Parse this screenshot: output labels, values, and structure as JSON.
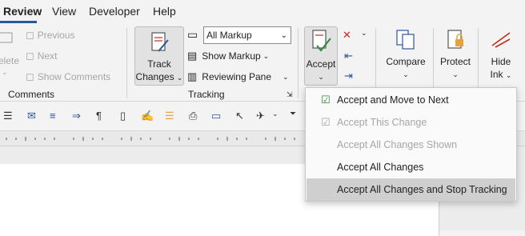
{
  "tabs": [
    {
      "label": "Review",
      "active": true
    },
    {
      "label": "View"
    },
    {
      "label": "Developer"
    },
    {
      "label": "Help"
    }
  ],
  "comments": {
    "partial_left_label": "elete",
    "previous": "Previous",
    "next": "Next",
    "show_comments": "Show Comments",
    "group_label": "Comments"
  },
  "tracking": {
    "track_changes_line1": "Track",
    "track_changes_line2": "Changes",
    "markup_combo": "All Markup",
    "show_markup": "Show Markup",
    "reviewing_pane": "Reviewing Pane",
    "group_label": "Tracking"
  },
  "accept": {
    "label": "Accept"
  },
  "compare": {
    "label": "Compare"
  },
  "protect": {
    "label": "Protect"
  },
  "hide_ink": {
    "line1": "Hide",
    "line2": "Ink"
  },
  "accept_menu": {
    "items": [
      {
        "label": "Accept and Move to Next",
        "enabled": true,
        "highlighted": false,
        "icon": "accept-move-next-icon"
      },
      {
        "label": "Accept This Change",
        "enabled": false,
        "highlighted": false,
        "icon": "accept-this-change-icon"
      },
      {
        "label": "Accept All Changes Shown",
        "enabled": false,
        "highlighted": false
      },
      {
        "label": "Accept All Changes",
        "enabled": true,
        "highlighted": false
      },
      {
        "label": "Accept All Changes and Stop Tracking",
        "enabled": true,
        "highlighted": true
      }
    ]
  },
  "colors": {
    "accent": "#2b579a",
    "disabled_text": "#a6a6a6",
    "highlight": "#cfcfcf",
    "red_icon": "#c42b1c"
  }
}
